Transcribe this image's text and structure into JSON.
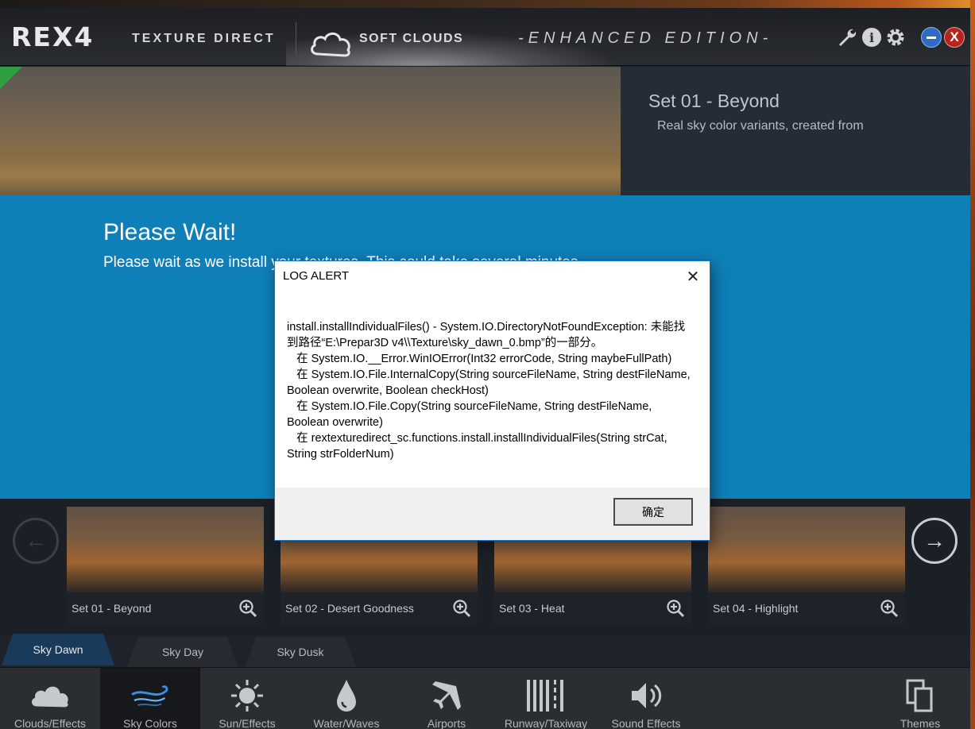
{
  "header": {
    "brand": "REX4",
    "product": "TEXTURE DIRECT",
    "addon": "SOFT CLOUDS",
    "edition": "-ENHANCED EDITION-",
    "info_glyph": "i",
    "close_glyph": "X"
  },
  "hero": {
    "title": "Set 01 - Beyond",
    "description": "Real sky color variants, created from"
  },
  "wait": {
    "title": "Please Wait!",
    "message": "Please wait as we install your textures. This could take several minutes."
  },
  "thumbnails": [
    {
      "label": "Set 01 - Beyond"
    },
    {
      "label": "Set 02 - Desert Goodness"
    },
    {
      "label": "Set 03 - Heat"
    },
    {
      "label": "Set 04 - Highlight"
    }
  ],
  "nav": {
    "prev": "←",
    "next": "→"
  },
  "subtabs": [
    {
      "label": "Sky Dawn",
      "active": true
    },
    {
      "label": "Sky Day",
      "active": false
    },
    {
      "label": "Sky Dusk",
      "active": false
    }
  ],
  "categories": [
    {
      "label": "Clouds/Effects",
      "icon": "cloud-icon"
    },
    {
      "label": "Sky Colors",
      "icon": "wind-icon",
      "active": true
    },
    {
      "label": "Sun/Effects",
      "icon": "sun-icon"
    },
    {
      "label": "Water/Waves",
      "icon": "water-drop-icon"
    },
    {
      "label": "Airports",
      "icon": "airplane-icon"
    },
    {
      "label": "Runway/Taxiway",
      "icon": "runway-icon"
    },
    {
      "label": "Sound Effects",
      "icon": "speaker-icon"
    },
    {
      "label": "Themes",
      "icon": "themes-icon"
    }
  ],
  "dialog": {
    "title": "LOG ALERT",
    "close_glyph": "✕",
    "body": "install.installIndividualFiles() - System.IO.DirectoryNotFoundException: 未能找到路径“E:\\Prepar3D v4\\\\Texture\\sky_dawn_0.bmp”的一部分。\n   在 System.IO.__Error.WinIOError(Int32 errorCode, String maybeFullPath)\n   在 System.IO.File.InternalCopy(String sourceFileName, String destFileName, Boolean overwrite, Boolean checkHost)\n   在 System.IO.File.Copy(String sourceFileName, String destFileName, Boolean overwrite)\n   在 rextexturedirect_sc.functions.install.installIndividualFiles(String strCat, String strFolderNum)",
    "ok_label": "确定"
  },
  "colors": {
    "overlay_blue": "#0f7fb8",
    "dialog_border": "#1979c9",
    "active_tab": "#1a3a5c",
    "corner_marker": "#2ea043"
  }
}
